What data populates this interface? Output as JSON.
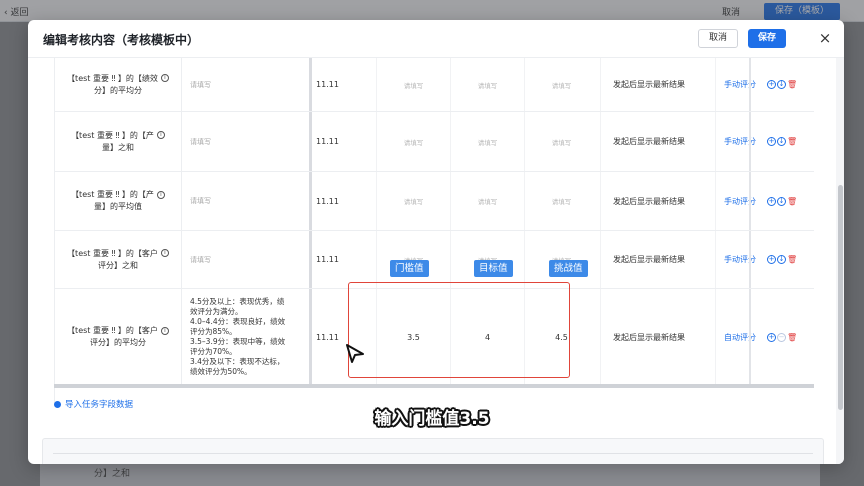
{
  "background": {
    "back_label": "返回",
    "cancel_label": "取消",
    "save_label": "保存（模板）",
    "bottom_text": "分】之和"
  },
  "modal": {
    "title": "编辑考核内容（考核模板中）",
    "cancel_label": "取消",
    "save_label": "保存",
    "close_icon": "×"
  },
  "table": {
    "rows": [
      {
        "name_line1": "【test 重要 ‼ 】的【绩效",
        "name_line2": "分】的平均分",
        "desc": "请填写",
        "weight": "11.11",
        "threshold": "请填写",
        "target": "请填写",
        "challenge": "请填写",
        "result": "发起后显示最新结果",
        "mode": "手动评分"
      },
      {
        "name_line1": "【test 重要 ‼ 】的【产",
        "name_line2": "量】之和",
        "desc": "请填写",
        "weight": "11.11",
        "threshold": "请填写",
        "target": "请填写",
        "challenge": "请填写",
        "result": "发起后显示最新结果",
        "mode": "手动评分"
      },
      {
        "name_line1": "【test 重要 ‼ 】的【产",
        "name_line2": "量】的平均值",
        "desc": "请填写",
        "weight": "11.11",
        "threshold": "请填写",
        "target": "请填写",
        "challenge": "请填写",
        "result": "发起后显示最新结果",
        "mode": "手动评分"
      },
      {
        "name_line1": "【test 重要 ‼ 】的【客户",
        "name_line2": "评分】之和",
        "desc": "请填写",
        "weight": "11.11",
        "threshold": "请填写",
        "target": "请填写",
        "challenge": "请填写",
        "result": "发起后显示最新结果",
        "mode": "手动评分"
      },
      {
        "name_line1": "【test 重要 ‼ 】的【客户",
        "name_line2": "评分】的平均分",
        "desc_lines": [
          "4.5分及以上：表现优秀，绩",
          "效评分为满分。",
          "4.0–4.4分：表现良好，绩效",
          "评分为85%。",
          "3.5–3.9分：表现中等，绩效",
          "评分为70%。",
          "3.4分及以下：表现不达标，",
          "绩效评分为50%。"
        ],
        "weight": "11.11",
        "threshold": "3.5",
        "target": "4",
        "challenge": "4.5",
        "result": "发起后显示最新结果",
        "mode": "自动评分"
      }
    ]
  },
  "tags": {
    "threshold": "门槛值",
    "target": "目标值",
    "challenge": "挑战值"
  },
  "import_link": "导入任务字段数据",
  "caption": "输入门槛值3.5",
  "colors": {
    "primary": "#1e6fe8",
    "highlight": "#e0453a",
    "tag": "#3d8ae8"
  }
}
